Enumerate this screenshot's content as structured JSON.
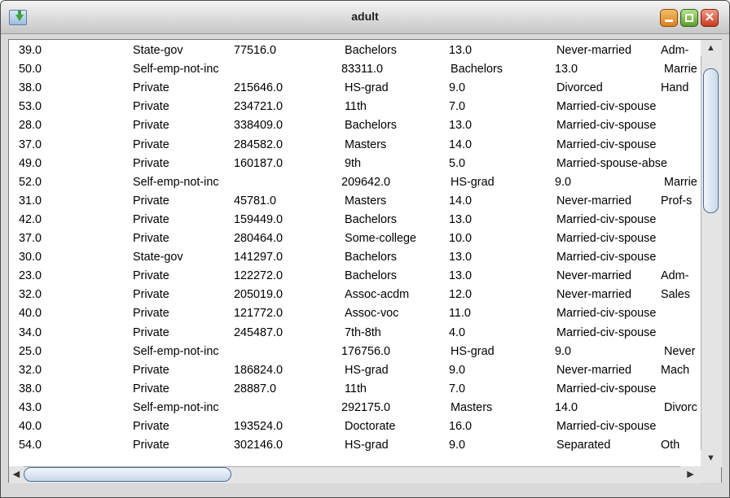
{
  "window": {
    "title": "adult"
  },
  "rows": [
    [
      "39.0",
      "State-gov",
      "77516.0",
      "Bachelors",
      "13.0",
      "Never-married",
      "Adm-"
    ],
    [
      "50.0",
      "Self-emp-not-inc",
      "",
      "83311.0",
      "Bachelors",
      "13.0",
      "Marrie"
    ],
    [
      "38.0",
      "Private",
      "215646.0",
      "HS-grad",
      "9.0",
      "Divorced",
      "Hand"
    ],
    [
      "53.0",
      "Private",
      "234721.0",
      "11th",
      "7.0",
      "Married-civ-spouse",
      ""
    ],
    [
      "28.0",
      "Private",
      "338409.0",
      "Bachelors",
      "13.0",
      "Married-civ-spouse",
      ""
    ],
    [
      "37.0",
      "Private",
      "284582.0",
      "Masters",
      "14.0",
      "Married-civ-spouse",
      ""
    ],
    [
      "49.0",
      "Private",
      "160187.0",
      "9th",
      "5.0",
      "Married-spouse-abse",
      ""
    ],
    [
      "52.0",
      "Self-emp-not-inc",
      "",
      "209642.0",
      "HS-grad",
      "9.0",
      "Marrie"
    ],
    [
      "31.0",
      "Private",
      "45781.0",
      "Masters",
      "14.0",
      "Never-married",
      "Prof-s"
    ],
    [
      "42.0",
      "Private",
      "159449.0",
      "Bachelors",
      "13.0",
      "Married-civ-spouse",
      ""
    ],
    [
      "37.0",
      "Private",
      "280464.0",
      "Some-college",
      "10.0",
      "Married-civ-spouse",
      ""
    ],
    [
      "30.0",
      "State-gov",
      "141297.0",
      "Bachelors",
      "13.0",
      "Married-civ-spouse",
      ""
    ],
    [
      "23.0",
      "Private",
      "122272.0",
      "Bachelors",
      "13.0",
      "Never-married",
      "Adm-"
    ],
    [
      "32.0",
      "Private",
      "205019.0",
      "Assoc-acdm",
      "12.0",
      "Never-married",
      "Sales"
    ],
    [
      "40.0",
      "Private",
      "121772.0",
      "Assoc-voc",
      "11.0",
      "Married-civ-spouse",
      ""
    ],
    [
      "34.0",
      "Private",
      "245487.0",
      "7th-8th",
      "4.0",
      "Married-civ-spouse",
      ""
    ],
    [
      "25.0",
      "Self-emp-not-inc",
      "",
      "176756.0",
      "HS-grad",
      "9.0",
      "Never"
    ],
    [
      "32.0",
      "Private",
      "186824.0",
      "HS-grad",
      "9.0",
      "Never-married",
      "Mach"
    ],
    [
      "38.0",
      "Private",
      "28887.0",
      "11th",
      "7.0",
      "Married-civ-spouse",
      ""
    ],
    [
      "43.0",
      "Self-emp-not-inc",
      "",
      "292175.0",
      "Masters",
      "14.0",
      "Divorc"
    ],
    [
      "40.0",
      "Private",
      "193524.0",
      "Doctorate",
      "16.0",
      "Married-civ-spouse",
      ""
    ],
    [
      "54.0",
      "Private",
      "302146.0",
      "HS-grad",
      "9.0",
      "Separated",
      "Oth"
    ]
  ],
  "icons": {
    "app": "download-arrow-icon",
    "minimize": "minimize-icon",
    "maximize": "maximize-icon",
    "close": "close-icon",
    "scroll_up": "arrow-up-icon",
    "scroll_down": "arrow-down-icon",
    "scroll_left": "arrow-left-icon",
    "scroll_right": "arrow-right-icon"
  },
  "glyphs": {
    "close": "✕",
    "up": "▲",
    "down": "▼",
    "left": "◀",
    "right": "▶"
  },
  "colors": {
    "minimize": "#e08a2a",
    "maximize": "#6aa83a",
    "close": "#d0442c",
    "scroll_thumb_border": "#4a6f99"
  }
}
